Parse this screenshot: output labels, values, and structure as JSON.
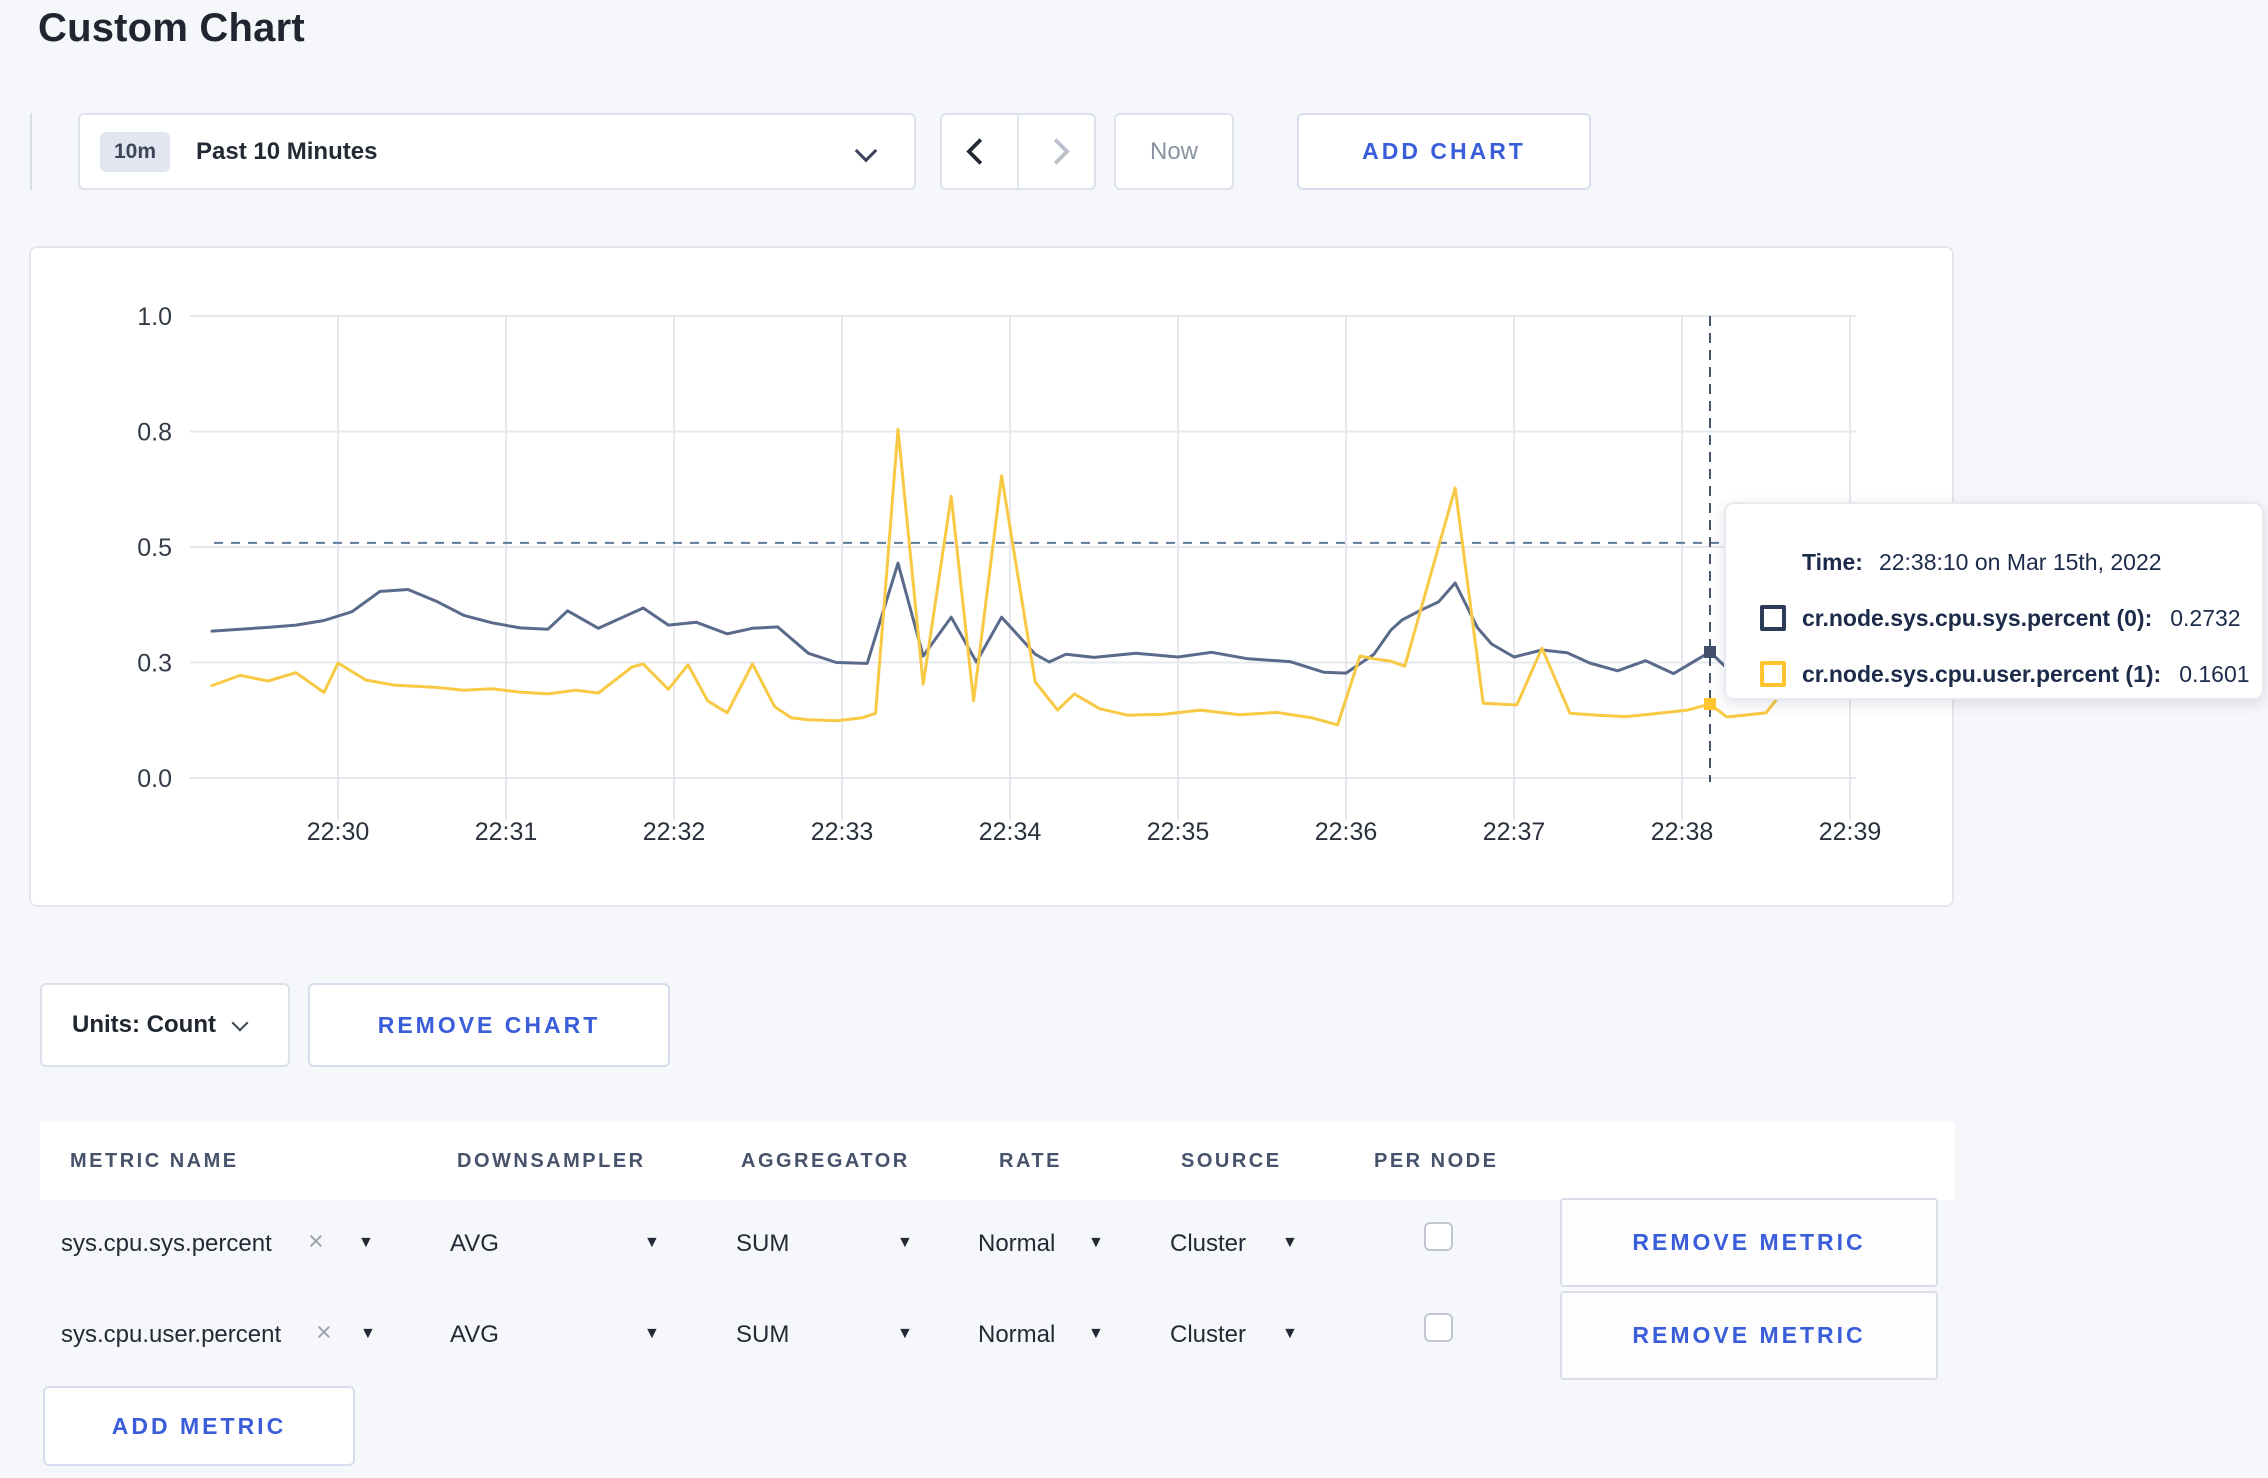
{
  "page": {
    "title": "Custom Chart"
  },
  "toolbar": {
    "range_badge": "10m",
    "range_label": "Past 10 Minutes",
    "now_label": "Now",
    "add_chart_label": "ADD CHART"
  },
  "chart_actions": {
    "units_label": "Units: Count",
    "remove_chart_label": "REMOVE CHART"
  },
  "tooltip": {
    "time_label": "Time:",
    "time_value": "22:38:10 on Mar 15th, 2022",
    "rows": [
      {
        "label": "cr.node.sys.cpu.sys.percent (0):",
        "value": "0.2732",
        "color": "#2b3a56"
      },
      {
        "label": "cr.node.sys.cpu.user.percent (1):",
        "value": "0.1601",
        "color": "#ffc531"
      }
    ]
  },
  "chart_data": {
    "type": "line",
    "title": "",
    "xlabel": "",
    "ylabel": "",
    "ylim": [
      0,
      1
    ],
    "grid": true,
    "legend_position": "none",
    "y_ticks": [
      "0.0",
      "0.3",
      "0.5",
      "0.8",
      "1.0"
    ],
    "y_tick_positions": [
      0,
      0.25,
      0.5,
      0.75,
      1.0
    ],
    "x_ticks": [
      "22:30",
      "22:31",
      "22:32",
      "22:33",
      "22:34",
      "22:35",
      "22:36",
      "22:37",
      "22:38",
      "22:39"
    ],
    "x_tick_seconds": [
      60,
      120,
      180,
      240,
      300,
      360,
      420,
      480,
      540,
      600
    ],
    "time_window": "22:29:15 - 22:39:02 on Mar 15th, 2022",
    "guideline_value": 0.509,
    "crosshair_seconds": 550,
    "markers": [
      {
        "t": 550,
        "v": 0.2727,
        "color": "#42506c"
      },
      {
        "t": 550,
        "v": 0.1601,
        "color": "#ffc531"
      }
    ],
    "series": [
      {
        "name": "cr.node.sys.cpu.sys.percent",
        "color": "#5a6a8a",
        "points": [
          [
            15,
            0.318
          ],
          [
            25,
            0.322
          ],
          [
            35,
            0.326
          ],
          [
            45,
            0.331
          ],
          [
            55,
            0.341
          ],
          [
            65,
            0.36
          ],
          [
            75,
            0.404
          ],
          [
            85,
            0.408
          ],
          [
            95,
            0.383
          ],
          [
            105,
            0.352
          ],
          [
            115,
            0.336
          ],
          [
            125,
            0.325
          ],
          [
            135,
            0.322
          ],
          [
            142,
            0.362
          ],
          [
            153,
            0.324
          ],
          [
            169,
            0.368
          ],
          [
            178,
            0.331
          ],
          [
            188,
            0.337
          ],
          [
            199,
            0.312
          ],
          [
            208,
            0.324
          ],
          [
            217,
            0.327
          ],
          [
            228,
            0.27
          ],
          [
            238,
            0.25
          ],
          [
            249,
            0.248
          ],
          [
            260,
            0.465
          ],
          [
            269,
            0.264
          ],
          [
            279,
            0.348
          ],
          [
            288,
            0.251
          ],
          [
            297,
            0.348
          ],
          [
            309,
            0.268
          ],
          [
            314,
            0.251
          ],
          [
            320,
            0.268
          ],
          [
            330,
            0.261
          ],
          [
            345,
            0.27
          ],
          [
            360,
            0.262
          ],
          [
            372,
            0.272
          ],
          [
            385,
            0.258
          ],
          [
            400,
            0.252
          ],
          [
            412,
            0.229
          ],
          [
            420,
            0.227
          ],
          [
            430,
            0.268
          ],
          [
            436,
            0.32
          ],
          [
            440,
            0.342
          ],
          [
            447,
            0.364
          ],
          [
            453,
            0.381
          ],
          [
            459,
            0.422
          ],
          [
            467,
            0.325
          ],
          [
            472,
            0.29
          ],
          [
            480,
            0.262
          ],
          [
            490,
            0.277
          ],
          [
            499,
            0.271
          ],
          [
            507,
            0.249
          ],
          [
            517,
            0.232
          ],
          [
            527,
            0.254
          ],
          [
            537,
            0.226
          ],
          [
            550,
            0.273
          ],
          [
            556,
            0.238
          ],
          [
            565,
            0.243
          ],
          [
            575,
            0.26
          ],
          [
            585,
            0.276
          ],
          [
            595,
            0.254
          ],
          [
            602,
            0.268
          ]
        ]
      },
      {
        "name": "cr.node.sys.cpu.user.percent",
        "color": "#f8c944",
        "points": [
          [
            15,
            0.2
          ],
          [
            25,
            0.222
          ],
          [
            35,
            0.21
          ],
          [
            45,
            0.228
          ],
          [
            55,
            0.185
          ],
          [
            60,
            0.249
          ],
          [
            70,
            0.212
          ],
          [
            80,
            0.201
          ],
          [
            95,
            0.196
          ],
          [
            105,
            0.19
          ],
          [
            115,
            0.193
          ],
          [
            125,
            0.186
          ],
          [
            135,
            0.182
          ],
          [
            145,
            0.19
          ],
          [
            153,
            0.184
          ],
          [
            165,
            0.24
          ],
          [
            169,
            0.247
          ],
          [
            178,
            0.192
          ],
          [
            185,
            0.245
          ],
          [
            192,
            0.167
          ],
          [
            199,
            0.141
          ],
          [
            208,
            0.247
          ],
          [
            216,
            0.154
          ],
          [
            222,
            0.13
          ],
          [
            228,
            0.126
          ],
          [
            238,
            0.124
          ],
          [
            247,
            0.13
          ],
          [
            252,
            0.14
          ],
          [
            260,
            0.755
          ],
          [
            269,
            0.203
          ],
          [
            279,
            0.61
          ],
          [
            287,
            0.167
          ],
          [
            297,
            0.654
          ],
          [
            309,
            0.208
          ],
          [
            317,
            0.147
          ],
          [
            323,
            0.182
          ],
          [
            332,
            0.15
          ],
          [
            342,
            0.136
          ],
          [
            355,
            0.138
          ],
          [
            368,
            0.147
          ],
          [
            382,
            0.137
          ],
          [
            395,
            0.142
          ],
          [
            408,
            0.13
          ],
          [
            417,
            0.115
          ],
          [
            425,
            0.264
          ],
          [
            430,
            0.258
          ],
          [
            436,
            0.253
          ],
          [
            441,
            0.242
          ],
          [
            459,
            0.628
          ],
          [
            469,
            0.162
          ],
          [
            481,
            0.158
          ],
          [
            490,
            0.281
          ],
          [
            500,
            0.14
          ],
          [
            510,
            0.136
          ],
          [
            520,
            0.133
          ],
          [
            533,
            0.141
          ],
          [
            542,
            0.147
          ],
          [
            550,
            0.16
          ],
          [
            556,
            0.132
          ],
          [
            570,
            0.141
          ],
          [
            580,
            0.219
          ],
          [
            595,
            0.223
          ],
          [
            602,
            0.175
          ]
        ]
      }
    ]
  },
  "metrics_table": {
    "headers": [
      "METRIC NAME",
      "DOWNSAMPLER",
      "AGGREGATOR",
      "RATE",
      "SOURCE",
      "PER NODE"
    ],
    "rows": [
      {
        "name": "sys.cpu.sys.percent",
        "remove": "×",
        "downsampler": "AVG",
        "aggregator": "SUM",
        "rate": "Normal",
        "source": "Cluster",
        "per_node_checked": false,
        "remove_label": "REMOVE METRIC"
      },
      {
        "name": "sys.cpu.user.percent",
        "remove": "×",
        "downsampler": "AVG",
        "aggregator": "SUM",
        "rate": "Normal",
        "source": "Cluster",
        "per_node_checked": false,
        "remove_label": "REMOVE METRIC"
      }
    ],
    "add_metric_label": "ADD METRIC"
  }
}
